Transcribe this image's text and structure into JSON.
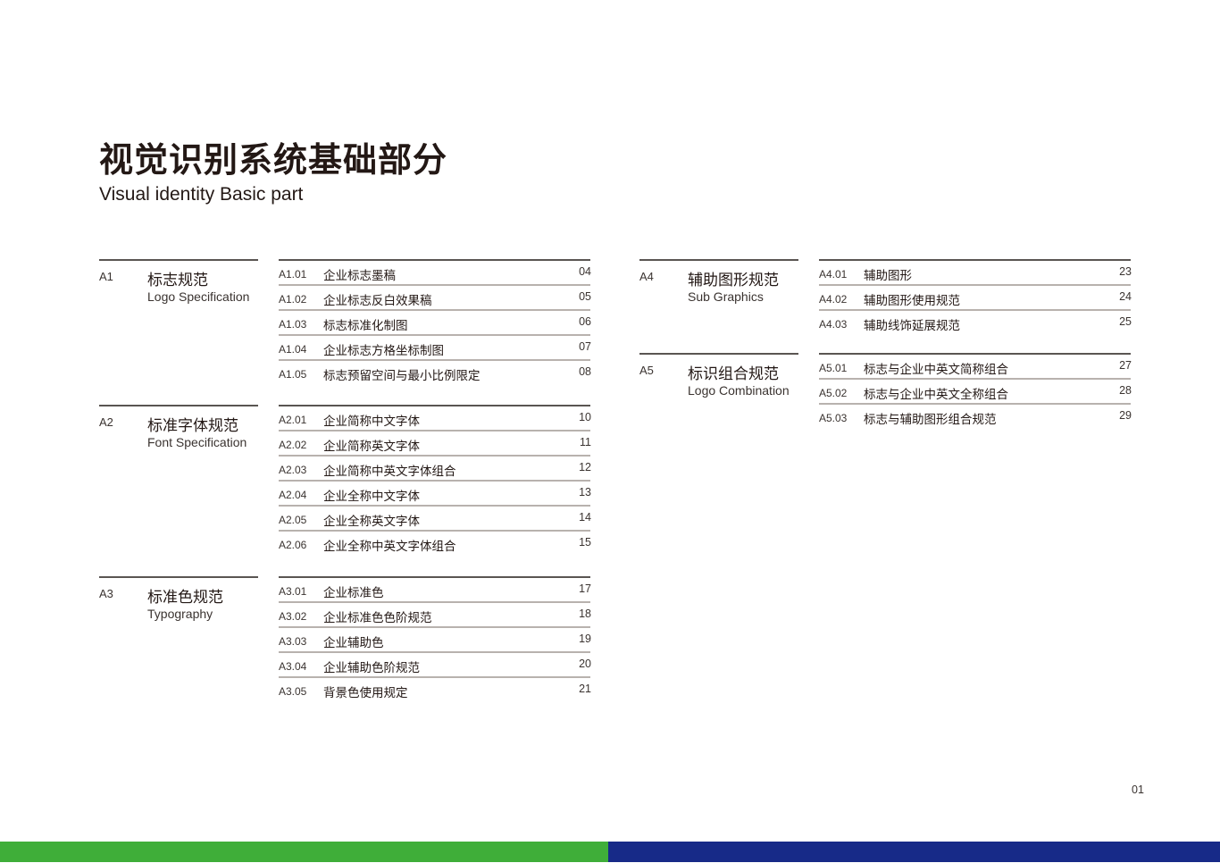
{
  "header": {
    "title_cn": "视觉识别系统基础部分",
    "title_en": "Visual identity Basic part"
  },
  "sections": [
    {
      "code": "A1",
      "title_cn": "标志规范",
      "title_en": "Logo Specification",
      "items": [
        {
          "code": "A1.01",
          "title": "企业标志墨稿",
          "page": "04"
        },
        {
          "code": "A1.02",
          "title": "企业标志反白效果稿",
          "page": "05"
        },
        {
          "code": "A1.03",
          "title": "标志标准化制图",
          "page": "06"
        },
        {
          "code": "A1.04",
          "title": "企业标志方格坐标制图",
          "page": "07"
        },
        {
          "code": "A1.05",
          "title": "标志预留空间与最小比例限定",
          "page": "08"
        }
      ]
    },
    {
      "code": "A2",
      "title_cn": "标准字体规范",
      "title_en": "Font Specification",
      "items": [
        {
          "code": "A2.01",
          "title": "企业简称中文字体",
          "page": "10"
        },
        {
          "code": "A2.02",
          "title": "企业简称英文字体",
          "page": "11"
        },
        {
          "code": "A2.03",
          "title": "企业简称中英文字体组合",
          "page": "12"
        },
        {
          "code": "A2.04",
          "title": "企业全称中文字体",
          "page": "13"
        },
        {
          "code": "A2.05",
          "title": "企业全称英文字体",
          "page": "14"
        },
        {
          "code": "A2.06",
          "title": "企业全称中英文字体组合",
          "page": "15"
        }
      ]
    },
    {
      "code": "A3",
      "title_cn": "标准色规范",
      "title_en": "Typography",
      "items": [
        {
          "code": "A3.01",
          "title": "企业标准色",
          "page": "17"
        },
        {
          "code": "A3.02",
          "title": "企业标准色色阶规范",
          "page": "18"
        },
        {
          "code": "A3.03",
          "title": "企业辅助色",
          "page": "19"
        },
        {
          "code": "A3.04",
          "title": "企业辅助色阶规范",
          "page": "20"
        },
        {
          "code": "A3.05",
          "title": "背景色使用规定",
          "page": "21"
        }
      ]
    },
    {
      "code": "A4",
      "title_cn": "辅助图形规范",
      "title_en": "Sub Graphics",
      "items": [
        {
          "code": "A4.01",
          "title": "辅助图形",
          "page": "23"
        },
        {
          "code": "A4.02",
          "title": "辅助图形使用规范",
          "page": "24"
        },
        {
          "code": "A4.03",
          "title": "辅助线饰延展规范",
          "page": "25"
        }
      ]
    },
    {
      "code": "A5",
      "title_cn": "标识组合规范",
      "title_en": "Logo Combination",
      "items": [
        {
          "code": "A5.01",
          "title": "标志与企业中英文简称组合",
          "page": "27"
        },
        {
          "code": "A5.02",
          "title": "标志与企业中英文全称组合",
          "page": "28"
        },
        {
          "code": "A5.03",
          "title": "标志与辅助图形组合规范",
          "page": "29"
        }
      ]
    }
  ],
  "footer": {
    "page_number": "01",
    "colors": {
      "primary_green": "#3fae39",
      "primary_blue": "#172a88"
    }
  }
}
